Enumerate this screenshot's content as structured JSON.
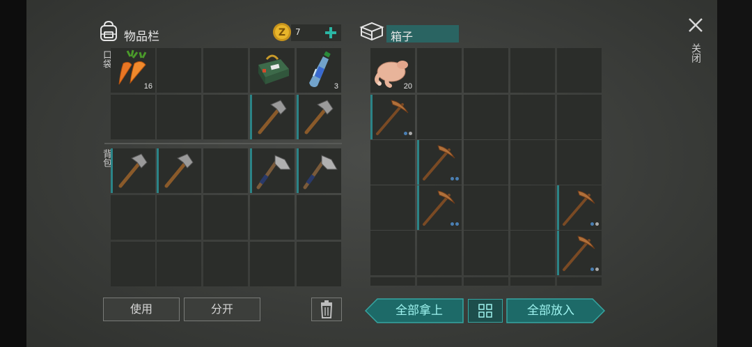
{
  "inventory": {
    "title": "物品栏",
    "coins": "7",
    "section_pocket": "口袋",
    "section_backpack": "背包",
    "items": {
      "carrot_qty": "16",
      "bottle_qty": "3"
    },
    "use_label": "使用",
    "split_label": "分开"
  },
  "box": {
    "title": "箱子",
    "chicken_qty": "20",
    "take_all_label": "全部拿上",
    "put_all_label": "全部放入"
  },
  "close_label": "关闭",
  "colors": {
    "accent": "#2b8487",
    "button_teal": "#1d6a68",
    "button_text": "#9ef3ef"
  }
}
